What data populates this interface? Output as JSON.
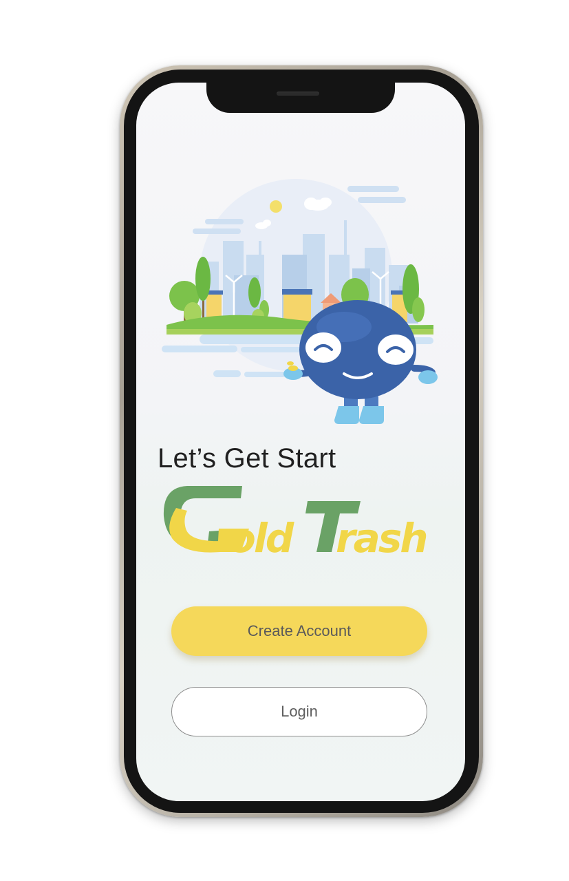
{
  "screen": {
    "heading": "Let’s Get Start",
    "logo_part1": "Gold",
    "logo_part2": "Trash",
    "illustration_icon": "eco-city-mascot-illustration"
  },
  "buttons": {
    "create_account": "Create Account",
    "login": "Login"
  },
  "colors": {
    "accent_yellow": "#f5d85a",
    "logo_green": "#6aa266",
    "logo_yellow": "#f1d648",
    "mascot_blue": "#3b63a8"
  }
}
